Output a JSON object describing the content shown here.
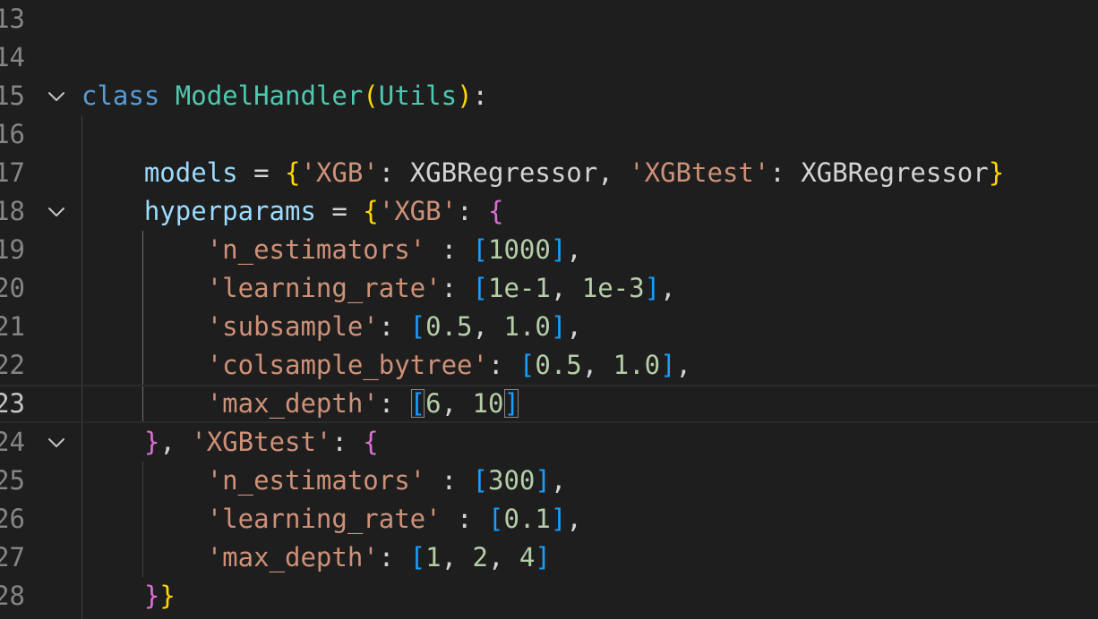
{
  "editor": {
    "lines": [
      {
        "number": "13",
        "tokens": []
      },
      {
        "number": "14",
        "tokens": []
      },
      {
        "number": "15",
        "fold": true,
        "tokens": [
          {
            "t": "class",
            "c": "kw"
          },
          {
            "t": " ",
            "c": "pun"
          },
          {
            "t": "ModelHandler",
            "c": "cls"
          },
          {
            "t": "(",
            "c": "b1"
          },
          {
            "t": "Utils",
            "c": "cls"
          },
          {
            "t": ")",
            "c": "b1"
          },
          {
            "t": ":",
            "c": "pun"
          }
        ]
      },
      {
        "number": "16",
        "tokens": []
      },
      {
        "number": "17",
        "tokens": [
          {
            "t": "    ",
            "c": "pun"
          },
          {
            "t": "models",
            "c": "var"
          },
          {
            "t": " = ",
            "c": "pun"
          },
          {
            "t": "{",
            "c": "b1"
          },
          {
            "t": "'XGB'",
            "c": "str"
          },
          {
            "t": ": XGBRegressor, ",
            "c": "pun"
          },
          {
            "t": "'XGBtest'",
            "c": "str"
          },
          {
            "t": ": XGBRegressor",
            "c": "pun"
          },
          {
            "t": "}",
            "c": "b1"
          }
        ]
      },
      {
        "number": "18",
        "fold": true,
        "tokens": [
          {
            "t": "    ",
            "c": "pun"
          },
          {
            "t": "hyperparams",
            "c": "var"
          },
          {
            "t": " = ",
            "c": "pun"
          },
          {
            "t": "{",
            "c": "b1"
          },
          {
            "t": "'XGB'",
            "c": "str"
          },
          {
            "t": ": ",
            "c": "pun"
          },
          {
            "t": "{",
            "c": "b2"
          }
        ]
      },
      {
        "number": "19",
        "tokens": [
          {
            "t": "        ",
            "c": "pun"
          },
          {
            "t": "'n_estimators'",
            "c": "str"
          },
          {
            "t": " : ",
            "c": "pun"
          },
          {
            "t": "[",
            "c": "b3"
          },
          {
            "t": "1000",
            "c": "num"
          },
          {
            "t": "]",
            "c": "b3"
          },
          {
            "t": ",",
            "c": "pun"
          }
        ]
      },
      {
        "number": "20",
        "tokens": [
          {
            "t": "        ",
            "c": "pun"
          },
          {
            "t": "'learning_rate'",
            "c": "str"
          },
          {
            "t": ": ",
            "c": "pun"
          },
          {
            "t": "[",
            "c": "b3"
          },
          {
            "t": "1e-1",
            "c": "num"
          },
          {
            "t": ", ",
            "c": "pun"
          },
          {
            "t": "1e-3",
            "c": "num"
          },
          {
            "t": "]",
            "c": "b3"
          },
          {
            "t": ",",
            "c": "pun"
          }
        ]
      },
      {
        "number": "21",
        "tokens": [
          {
            "t": "        ",
            "c": "pun"
          },
          {
            "t": "'subsample'",
            "c": "str"
          },
          {
            "t": ": ",
            "c": "pun"
          },
          {
            "t": "[",
            "c": "b3"
          },
          {
            "t": "0.5",
            "c": "num"
          },
          {
            "t": ", ",
            "c": "pun"
          },
          {
            "t": "1.0",
            "c": "num"
          },
          {
            "t": "]",
            "c": "b3"
          },
          {
            "t": ",",
            "c": "pun"
          }
        ]
      },
      {
        "number": "22",
        "tokens": [
          {
            "t": "        ",
            "c": "pun"
          },
          {
            "t": "'colsample_bytree'",
            "c": "str"
          },
          {
            "t": ": ",
            "c": "pun"
          },
          {
            "t": "[",
            "c": "b3"
          },
          {
            "t": "0.5",
            "c": "num"
          },
          {
            "t": ", ",
            "c": "pun"
          },
          {
            "t": "1.0",
            "c": "num"
          },
          {
            "t": "]",
            "c": "b3"
          },
          {
            "t": ",",
            "c": "pun"
          }
        ]
      },
      {
        "number": "23",
        "current": true,
        "tokens": [
          {
            "t": "        ",
            "c": "pun"
          },
          {
            "t": "'max_depth'",
            "c": "str"
          },
          {
            "t": ": ",
            "c": "pun"
          },
          {
            "t": "[",
            "c": "b3",
            "match": true
          },
          {
            "t": "6",
            "c": "num"
          },
          {
            "t": ", ",
            "c": "pun"
          },
          {
            "t": "10",
            "c": "num"
          },
          {
            "t": "]",
            "c": "b3",
            "match": true
          }
        ]
      },
      {
        "number": "24",
        "fold": true,
        "tokens": [
          {
            "t": "    ",
            "c": "pun"
          },
          {
            "t": "}",
            "c": "b2"
          },
          {
            "t": ", ",
            "c": "pun"
          },
          {
            "t": "'XGBtest'",
            "c": "str"
          },
          {
            "t": ": ",
            "c": "pun"
          },
          {
            "t": "{",
            "c": "b2"
          }
        ]
      },
      {
        "number": "25",
        "tokens": [
          {
            "t": "        ",
            "c": "pun"
          },
          {
            "t": "'n_estimators'",
            "c": "str"
          },
          {
            "t": " : ",
            "c": "pun"
          },
          {
            "t": "[",
            "c": "b3"
          },
          {
            "t": "300",
            "c": "num"
          },
          {
            "t": "]",
            "c": "b3"
          },
          {
            "t": ",",
            "c": "pun"
          }
        ]
      },
      {
        "number": "26",
        "tokens": [
          {
            "t": "        ",
            "c": "pun"
          },
          {
            "t": "'learning_rate'",
            "c": "str"
          },
          {
            "t": " : ",
            "c": "pun"
          },
          {
            "t": "[",
            "c": "b3"
          },
          {
            "t": "0.1",
            "c": "num"
          },
          {
            "t": "]",
            "c": "b3"
          },
          {
            "t": ",",
            "c": "pun"
          }
        ]
      },
      {
        "number": "27",
        "tokens": [
          {
            "t": "        ",
            "c": "pun"
          },
          {
            "t": "'max_depth'",
            "c": "str"
          },
          {
            "t": ": ",
            "c": "pun"
          },
          {
            "t": "[",
            "c": "b3"
          },
          {
            "t": "1",
            "c": "num"
          },
          {
            "t": ", ",
            "c": "pun"
          },
          {
            "t": "2",
            "c": "num"
          },
          {
            "t": ", ",
            "c": "pun"
          },
          {
            "t": "4",
            "c": "num"
          },
          {
            "t": "]",
            "c": "b3"
          }
        ]
      },
      {
        "number": "28",
        "tokens": [
          {
            "t": "    ",
            "c": "pun"
          },
          {
            "t": "}",
            "c": "b2"
          },
          {
            "t": "}",
            "c": "b1"
          }
        ]
      }
    ]
  },
  "colors": {
    "background": "#1e1e1e",
    "keyword": "#569cd6",
    "class_name": "#4ec9b0",
    "variable": "#9cdcfe",
    "string": "#ce9178",
    "number": "#b5cea8",
    "bracket_level1": "#ffd700",
    "bracket_level2": "#da70d6",
    "bracket_level3": "#179fff",
    "line_number": "#858585"
  },
  "icons": {
    "fold": "chevron-down-icon"
  }
}
